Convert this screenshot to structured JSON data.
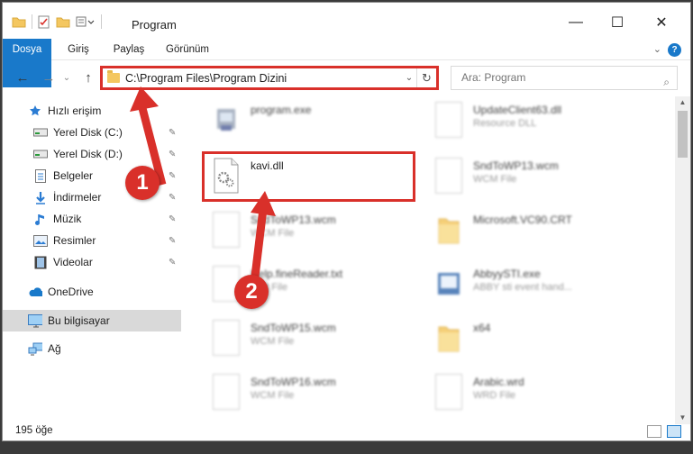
{
  "window": {
    "title": "Program",
    "minimize_glyph": "—",
    "maximize_glyph": "☐",
    "close_glyph": "✕"
  },
  "ribbon": {
    "tabs": [
      {
        "label": "Dosya",
        "active": true
      },
      {
        "label": "Giriş"
      },
      {
        "label": "Paylaş"
      },
      {
        "label": "Görünüm"
      }
    ],
    "expand_glyph": "⌄",
    "help_glyph": "?"
  },
  "nav": {
    "back_glyph": "←",
    "forward_glyph": "→",
    "recent_glyph": "⌄",
    "up_glyph": "↑",
    "address_path": "C:\\Program Files\\Program Dizini",
    "address_dropdown_glyph": "⌄",
    "refresh_glyph": "↻",
    "search_placeholder": "Ara: Program",
    "search_icon_glyph": "⌕"
  },
  "sidebar": {
    "items": [
      {
        "label": "Hızlı erişim",
        "icon": "star-icon",
        "pinned": false
      },
      {
        "label": "Yerel Disk (C:)",
        "icon": "drive-icon",
        "pinned": true
      },
      {
        "label": "Yerel Disk (D:)",
        "icon": "drive-icon",
        "pinned": true
      },
      {
        "label": "Belgeler",
        "icon": "documents-icon",
        "pinned": true
      },
      {
        "label": "İndirmeler",
        "icon": "download-icon",
        "pinned": true
      },
      {
        "label": "Müzik",
        "icon": "music-icon",
        "pinned": true
      },
      {
        "label": "Resimler",
        "icon": "pictures-icon",
        "pinned": true
      },
      {
        "label": "Videolar",
        "icon": "videos-icon",
        "pinned": true
      },
      {
        "label": "OneDrive",
        "icon": "onedrive-icon",
        "pinned": false
      },
      {
        "label": "Bu bilgisayar",
        "icon": "computer-icon",
        "pinned": false,
        "selected": true
      },
      {
        "label": "Ağ",
        "icon": "network-icon",
        "pinned": false
      }
    ],
    "pin_glyph": "📌"
  },
  "files": [
    {
      "name": "program.exe",
      "type": ""
    },
    {
      "name": "UpdateClient63.dll",
      "type": "Resource DLL"
    },
    {
      "name": "kavi.dll",
      "type": ""
    },
    {
      "name": "SndToWP13.wcm",
      "type": "WCM File"
    },
    {
      "name": "SndToWP13.wcm",
      "type": "WCM File"
    },
    {
      "name": "Microsoft.VC90.CRT",
      "type": ""
    },
    {
      "name": "Help.fineReader.txt",
      "type": "Text File"
    },
    {
      "name": "AbbyySTI.exe",
      "type": "ABBY sti event hand..."
    },
    {
      "name": "SndToWP15.wcm",
      "type": "WCM File"
    },
    {
      "name": "x64",
      "type": ""
    },
    {
      "name": "SndToWP16.wcm",
      "type": "WCM File"
    },
    {
      "name": "Arabic.wrd",
      "type": "WRD File"
    }
  ],
  "status": {
    "item_count": "195 öğe"
  },
  "annotations": {
    "step1": "1",
    "step2": "2"
  },
  "colors": {
    "accent": "#1979ca",
    "highlight_red": "#d9302a",
    "folder_yellow": "#f4c760"
  }
}
